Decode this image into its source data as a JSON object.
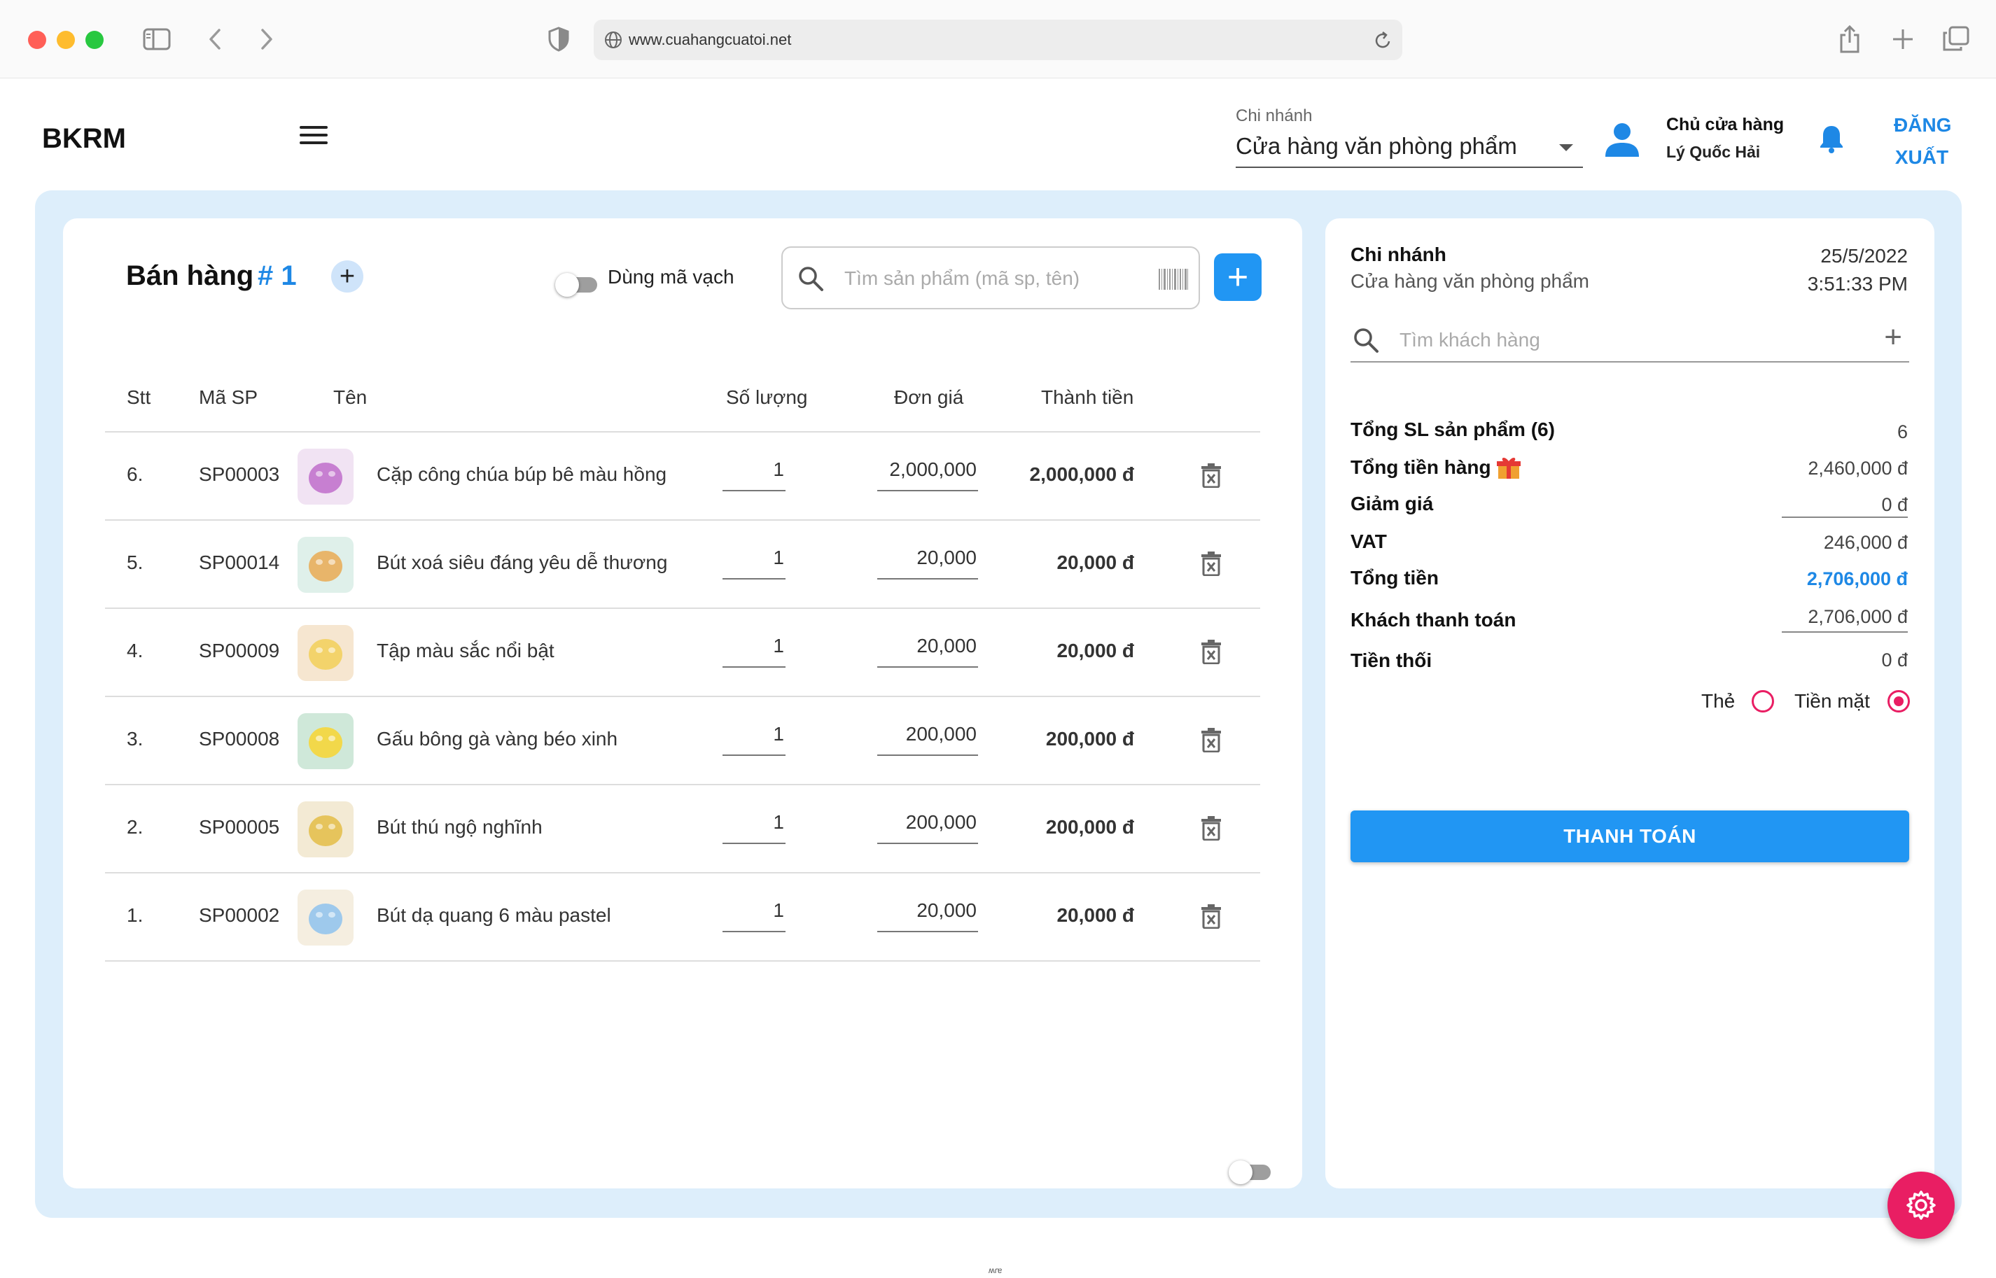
{
  "browser": {
    "url": "www.cuahangcuatoi.net"
  },
  "header": {
    "brand": "BKRM",
    "branch_label": "Chi nhánh",
    "branch_value": "Cửa hàng văn phòng phẩm",
    "user_role": "Chủ cửa hàng",
    "user_name": "Lý Quốc Hải",
    "logout_line1": "ĐĂNG",
    "logout_line2": "XUẤT"
  },
  "sale": {
    "title": "Bán hàng",
    "tab_number": "# 1",
    "add_tab_label": "+",
    "barcode_toggle_label": "Dùng mã vạch",
    "search_placeholder": "Tìm sản phẩm (mã sp, tên)",
    "add_product_label": "+"
  },
  "table": {
    "columns": [
      "Stt",
      "Mã SP",
      "Tên",
      "Số lượng",
      "Đơn giá",
      "Thành tiền"
    ],
    "rows": [
      {
        "stt": "6.",
        "code": "SP00003",
        "name": "Cặp công chúa búp bê màu hồng",
        "qty": "1",
        "price": "2,000,000",
        "total": "2,000,000 đ",
        "thumb_color": "#c77fd1",
        "thumb_bg": "#f1e3f3"
      },
      {
        "stt": "5.",
        "code": "SP00014",
        "name": "Bút xoá siêu đáng yêu dễ thương",
        "qty": "1",
        "price": "20,000",
        "total": "20,000 đ",
        "thumb_color": "#e8b56a",
        "thumb_bg": "#dff0ea"
      },
      {
        "stt": "4.",
        "code": "SP00009",
        "name": "Tập màu sắc nổi bật",
        "qty": "1",
        "price": "20,000",
        "total": "20,000 đ",
        "thumb_color": "#f3d36b",
        "thumb_bg": "#f6e6d0"
      },
      {
        "stt": "3.",
        "code": "SP00008",
        "name": "Gấu bông gà vàng béo xinh",
        "qty": "1",
        "price": "200,000",
        "total": "200,000 đ",
        "thumb_color": "#f2d84a",
        "thumb_bg": "#cfe8d9"
      },
      {
        "stt": "2.",
        "code": "SP00005",
        "name": "Bút thú ngộ nghĩnh",
        "qty": "1",
        "price": "200,000",
        "total": "200,000 đ",
        "thumb_color": "#e6c45c",
        "thumb_bg": "#f3ead4"
      },
      {
        "stt": "1.",
        "code": "SP00002",
        "name": "Bút dạ quang 6 màu pastel",
        "qty": "1",
        "price": "20,000",
        "total": "20,000 đ",
        "thumb_color": "#9ec9ec",
        "thumb_bg": "#f5eee0"
      }
    ]
  },
  "summary": {
    "branch_label": "Chi nhánh",
    "branch_value": "Cửa hàng văn phòng phẩm",
    "date": "25/5/2022",
    "time": "3:51:33 PM",
    "customer_placeholder": "Tìm khách hàng",
    "customer_add": "+",
    "lines": {
      "total_qty_label": "Tổng SL sản phẩm (6)",
      "total_qty": "6",
      "subtotal_label": "Tổng tiền hàng",
      "subtotal": "2,460,000 đ",
      "discount_label": "Giảm giá",
      "discount": "0 đ",
      "vat_label": "VAT",
      "vat": "246,000 đ",
      "grand_label": "Tổng tiền",
      "grand": "2,706,000 đ",
      "paid_label": "Khách thanh toán",
      "paid": "2,706,000 đ",
      "change_label": "Tiền thối",
      "change": "0 đ"
    },
    "payment": {
      "card_label": "Thẻ",
      "cash_label": "Tiền mặt",
      "selected": "cash"
    },
    "pay_button": "THANH TOÁN"
  },
  "colors": {
    "accent": "#1e88e5",
    "primary_button": "#2196f3",
    "fab": "#e91e63",
    "content_bg": "#ddeefb"
  },
  "icons": [
    "sidebar-icon",
    "back-icon",
    "forward-icon",
    "shield-icon",
    "globe-icon",
    "reload-icon",
    "share-icon",
    "new-tab-icon",
    "tabs-icon",
    "menu-icon",
    "user-icon",
    "bell-icon",
    "search-icon",
    "barcode-icon",
    "trash-icon",
    "gift-icon",
    "gear-icon"
  ],
  "footer_mark": "ʍɾɐ"
}
